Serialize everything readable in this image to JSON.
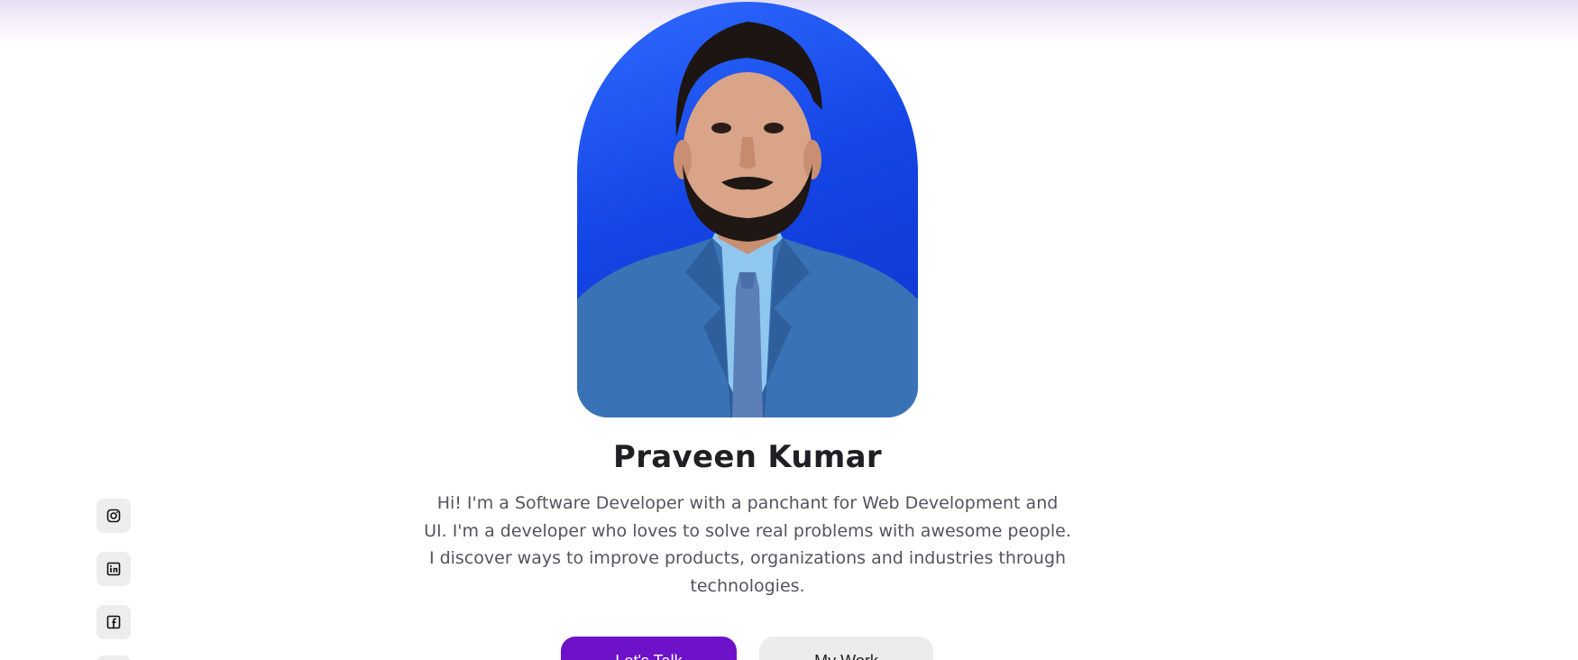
{
  "hero": {
    "name": "Praveen Kumar",
    "bio": "Hi! I'm a Software Developer with a panchant for Web Development and UI. I'm a developer who loves to solve real problems with awesome people. I discover ways to improve products, organizations and industries through technologies."
  },
  "social": [
    {
      "icon": "instagram-icon"
    },
    {
      "icon": "linkedin-icon"
    },
    {
      "icon": "facebook-icon"
    }
  ],
  "buttons": {
    "primary_label": "Let's Talk",
    "secondary_label": "My Work"
  },
  "colors": {
    "accent": "#6d12c9",
    "portrait_background": "#1545e6",
    "name_text": "#1f1f24",
    "bio_text": "#55535e",
    "social_bg": "#ededed"
  }
}
